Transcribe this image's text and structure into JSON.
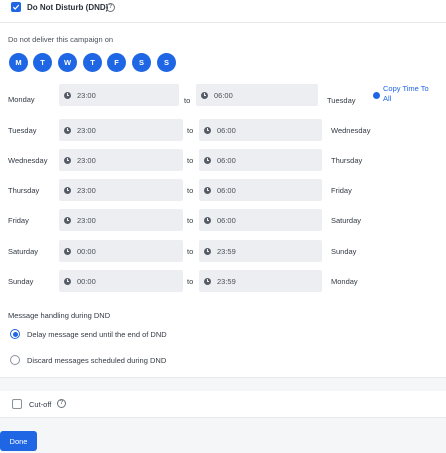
{
  "dnd": {
    "checked": true,
    "label": "Do Not Disturb (DND)",
    "help_glyph": "?"
  },
  "schedule": {
    "heading": "Do not deliver this campaign on",
    "day_buttons": [
      "M",
      "T",
      "W",
      "T",
      "F",
      "S",
      "S"
    ],
    "to_label": "to",
    "copy_link": "Copy Time To All",
    "rows": [
      {
        "day": "Monday",
        "start": "23:00",
        "end": "06:00",
        "end_day": "Tuesday"
      },
      {
        "day": "Tuesday",
        "start": "23:00",
        "end": "06:00",
        "end_day": "Wednesday"
      },
      {
        "day": "Wednesday",
        "start": "23:00",
        "end": "06:00",
        "end_day": "Thursday"
      },
      {
        "day": "Thursday",
        "start": "23:00",
        "end": "06:00",
        "end_day": "Friday"
      },
      {
        "day": "Friday",
        "start": "23:00",
        "end": "06:00",
        "end_day": "Saturday"
      },
      {
        "day": "Saturday",
        "start": "00:00",
        "end": "23:59",
        "end_day": "Sunday"
      },
      {
        "day": "Sunday",
        "start": "00:00",
        "end": "23:59",
        "end_day": "Monday"
      }
    ]
  },
  "handling": {
    "heading": "Message handling during DND",
    "options": [
      {
        "label": "Delay message send until the end of DND",
        "selected": true
      },
      {
        "label": "Discard messages scheduled during DND",
        "selected": false
      }
    ]
  },
  "cutoff": {
    "checked": false,
    "label": "Cut-off",
    "help_glyph": "?"
  },
  "footer": {
    "done_label": "Done"
  },
  "colors": {
    "accent": "#1f66e5",
    "field_bg": "#eceef1",
    "band_bg": "#f5f6f8"
  }
}
